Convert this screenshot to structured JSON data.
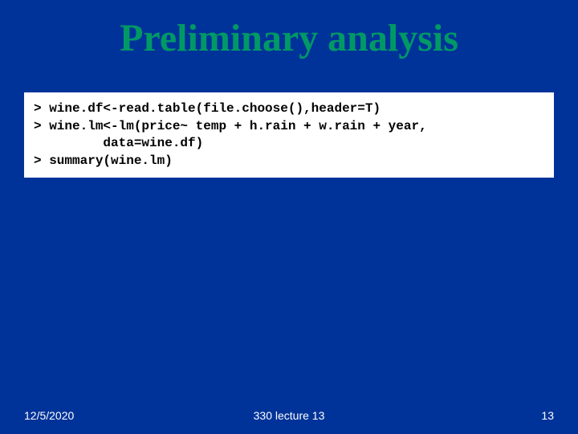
{
  "title": "Preliminary analysis",
  "code": "> wine.df<-read.table(file.choose(),header=T)\n> wine.lm<-lm(price~ temp + h.rain + w.rain + year,\n         data=wine.df)\n> summary(wine.lm)",
  "footer": {
    "date": "12/5/2020",
    "center": "330 lecture 13",
    "page": "13"
  }
}
